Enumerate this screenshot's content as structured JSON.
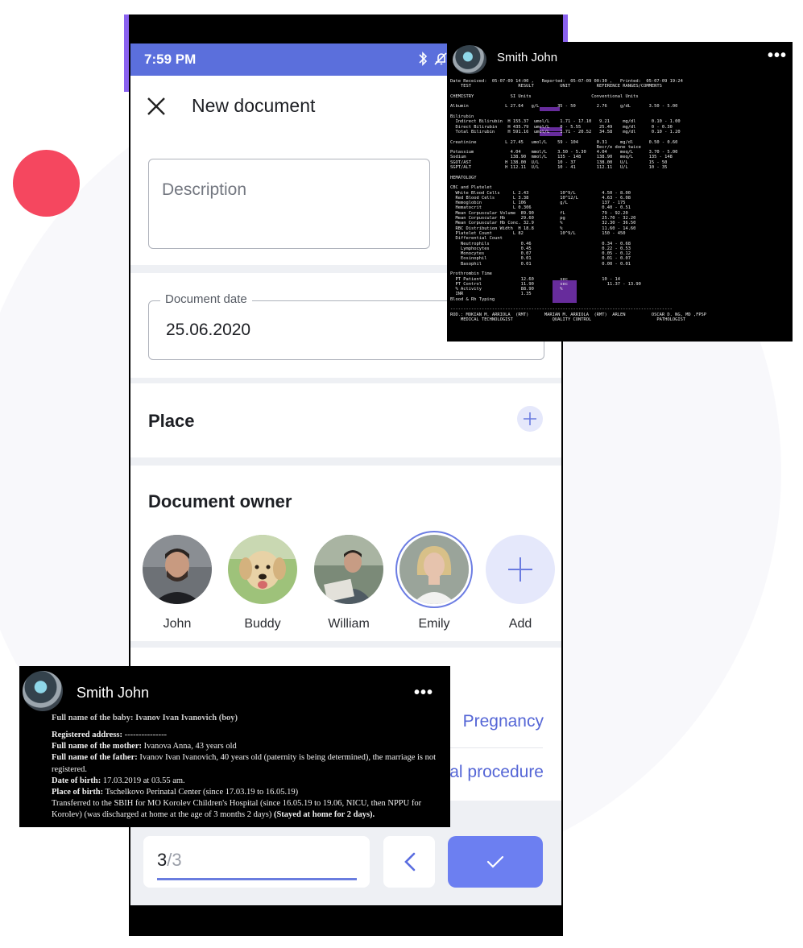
{
  "status": {
    "time": "7:59 PM"
  },
  "header": {
    "title": "New document"
  },
  "description": {
    "placeholder": "Description"
  },
  "document_date": {
    "label": "Document date",
    "value": "25.06.2020"
  },
  "place": {
    "title": "Place"
  },
  "owner": {
    "title": "Document owner",
    "people": [
      {
        "name": "John"
      },
      {
        "name": "Buddy"
      },
      {
        "name": "William"
      },
      {
        "name": "Emily"
      }
    ],
    "add_label": "Add"
  },
  "types": {
    "items": [
      "Pregnancy",
      "al procedure"
    ]
  },
  "pager": {
    "current": "3",
    "total": "/3"
  },
  "overlay_report": {
    "user": "Smith John",
    "dots": "•••",
    "lines": [
      "Date Received:  05-07-09 14:00 ,   Reported:  05-07-09 00:30 ,   Printed:  05-07-09 19:24",
      "    TEST                  RESULT          UNIT          REFERENCE RANGES/COMMENTS",
      "",
      "CHEMISTRY              SI Units                       Conventional Units",
      "",
      "Albumin              L 27.64   g/L       35 - 50        2.76     g/dL       3.50 - 5.00",
      "",
      "Bilirubin",
      "  Indirect Bilirubin  H 155.37  umol/L    1.71 - 17.10   9.21     mg/dl      0.10 - 1.00",
      "  Direct Bilirubin    H 435.79  umol/L    0 - 5.55       25.49    mg/dl      0 - 0.30",
      "  Total Bilirubin     H 591.16  umol/L    1.71 - 20.52   34.58    mg/dl      0.10 - 1.20",
      "",
      "Creatinine           L 27.45   umol/L    59 - 104       0.31     mg/dl      0.50 - 0.60",
      "                                                        Recr/e done twice",
      "Potassium              4.04    mmol/L    3.50 - 5.30    4.04     meq/L      3.70 - 5.00",
      "Sodium                 138.90  mmol/L    135 - 148      138.90   meq/L      135 - 148",
      "SGOT/AST             H 138.00  U/L       10 - 37        138.00   U/L        15 - 50",
      "SGPT/ALT             H 112.11  U/L       10 - 41        112.11   U/L        10 - 35",
      "",
      "HEMATOLOGY",
      "",
      "CBC and Platelet",
      "  White Blood Cells     L 2.43            10^9/L          4.50 - 8.00",
      "  Red Blood Cells       L 3.38            10^12/L         4.63 - 6.08",
      "  Hemoglobin            L 106             g/L             137 - 175",
      "  Hematocrit            L 0.306                           0.40 - 0.51",
      "  Mean Corpuscular Volume  89.90          fL              79 - 92.20",
      "  Mean Corpuscular Hb      29.60          pg              25.70 - 32.20",
      "  Mean Corpuscular Hb Conc. 32.9          %               32.30 - 36.50",
      "  RBC Distribution Width  H 18.8          %               11.60 - 14.60",
      "  Platelet Count        L 82              10^9/L          150 - 450",
      "  Differential Count",
      "    Neutrophils            0.46                           0.34 - 0.68",
      "    Lymphocytes            0.45                           0.22 - 0.53",
      "    Monocytes              0.07                           0.05 - 0.12",
      "    Eosinophil             0.01                           0.01 - 0.07",
      "    Basophil               0.01                           0.00 - 0.01",
      "",
      "Prothrombin Time",
      "  PT Patient               12.60          sec             10 - 14",
      "  PT Control               11.90          sec               11.37 - 13.90",
      "  % Activity               88.90          %",
      "  INR                      1.35",
      "Blood & Rh Typing",
      "",
      "-------------------------------------------------------------------------------------",
      "ROD.: MOKIAN M. ARRIOLA  (RMT)      MARIAN M. ARRIOLA  (RMT)  ARLEN          OSCAR D. NG, MD ,FPSP",
      "    MEDICAL TECHNOLOGIST               QUALITY CONTROL                         PATHOLOGIST"
    ]
  },
  "overlay_cert": {
    "user": "Smith John",
    "dots": "•••",
    "line0": "Full name of the baby: Ivanov Ivan Ivanovich (boy)",
    "addr_label": "Registered address:",
    "addr_value": " ---------------",
    "mother_label": "Full name of the mother:",
    "mother_value": " Ivanova Anna, 43 years old",
    "father_label": "Full name of the father:",
    "father_value": " Ivanov Ivan Ivanovich, 40 years old (paternity is being determined), the marriage is not registered.",
    "dob_label": "Date of birth:",
    "dob_value": " 17.03.2019 at 03.55 am.",
    "pob_label": "Place of birth:",
    "pob_value": " Tschelkovo Perinatal Center (since 17.03.19 to 16.05.19)",
    "transfer": "Transferred to the SBIH for MO Korolev Children's Hospital (since 16.05.19 to 19.06, NICU, then NPPU for Korolev) (was discharged at home at the age of 3 months 2 days)",
    "stayed": " (Stayed at home for 2 days)."
  }
}
